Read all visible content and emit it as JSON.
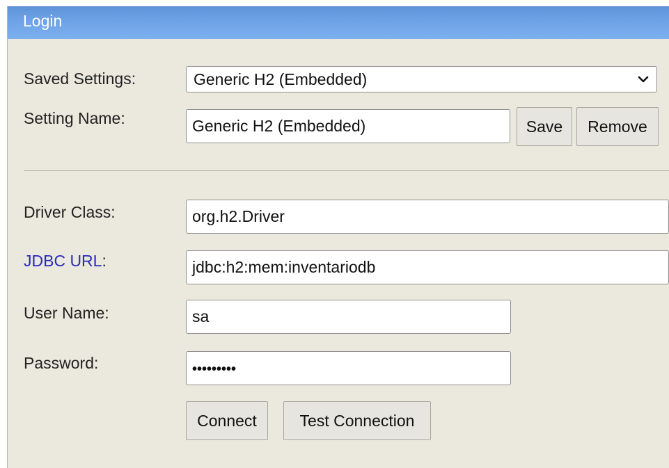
{
  "header": {
    "title": "Login"
  },
  "saved_settings": {
    "label": "Saved Settings:",
    "selected": "Generic H2 (Embedded)"
  },
  "setting_name": {
    "label": "Setting Name:",
    "value": "Generic H2 (Embedded)",
    "save_label": "Save",
    "remove_label": "Remove"
  },
  "driver_class": {
    "label": "Driver Class:",
    "value": "org.h2.Driver"
  },
  "jdbc_url": {
    "label": "JDBC URL",
    "colon": ":",
    "value": "jdbc:h2:mem:inventariodb"
  },
  "user_name": {
    "label": "User Name:",
    "value": "sa"
  },
  "password": {
    "label": "Password:",
    "masked_value": "•••••••••"
  },
  "actions": {
    "connect_label": "Connect",
    "test_label": "Test Connection"
  },
  "colors": {
    "title_bar": "#6da1e6",
    "panel_bg": "#ebe8dd",
    "link_label": "#2a2ac0"
  }
}
